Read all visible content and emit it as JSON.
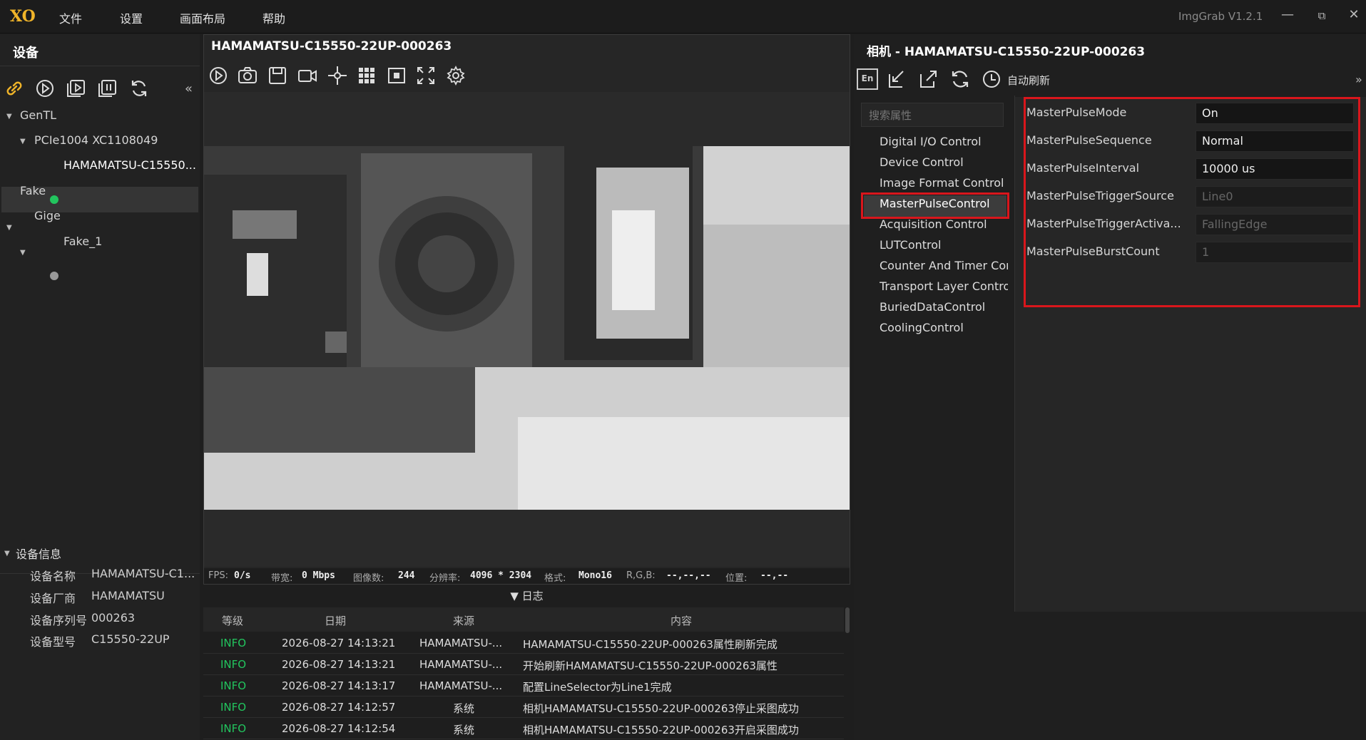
{
  "titlebar": {
    "logo": "XO",
    "menus": [
      "文件",
      "设置",
      "画面布局",
      "帮助"
    ],
    "app_version": "ImgGrab V1.2.1",
    "min_glyph": "—",
    "max_glyph": "⧉",
    "close_glyph": "✕"
  },
  "left_panel": {
    "title": "设备",
    "collapse_glyph": "«",
    "tree": {
      "gentl": "GenTL",
      "pcie": "PCIe1004 XC1108049",
      "hamamatsu": "HAMAMATSU-C15550...",
      "fake": "Fake",
      "gige": "Gige",
      "fake1": "Fake_1"
    },
    "info_title": "设备信息",
    "info": [
      {
        "label": "设备名称",
        "value": "HAMAMATSU-C1..."
      },
      {
        "label": "设备厂商",
        "value": "HAMAMATSU"
      },
      {
        "label": "设备序列号",
        "value": "000263"
      },
      {
        "label": "设备型号",
        "value": "C15550-22UP"
      }
    ]
  },
  "viewer": {
    "title": "HAMAMATSU-C15550-22UP-000263",
    "status": {
      "fps_label": "FPS:",
      "fps": "0/s",
      "bw_label": "带宽:",
      "bw": "0 Mbps",
      "count_label": "图像数:",
      "count": "244",
      "res_label": "分辨率:",
      "res": "4096 * 2304",
      "fmt_label": "格式:",
      "fmt": "Mono16",
      "rgb_label": "R,G,B:",
      "rgb": "--,--,--",
      "pos_label": "位置:",
      "pos": "--,--"
    }
  },
  "log": {
    "title": "▼ 日志",
    "columns": {
      "level": "等级",
      "date": "日期",
      "source": "来源",
      "content": "内容"
    },
    "rows": [
      {
        "level": "INFO",
        "date": "2026-08-27 14:13:21",
        "source": "HAMAMATSU-...",
        "content": "HAMAMATSU-C15550-22UP-000263属性刷新完成"
      },
      {
        "level": "INFO",
        "date": "2026-08-27 14:13:21",
        "source": "HAMAMATSU-...",
        "content": "开始刷新HAMAMATSU-C15550-22UP-000263属性"
      },
      {
        "level": "INFO",
        "date": "2026-08-27 14:13:17",
        "source": "HAMAMATSU-...",
        "content": "配置LineSelector为Line1完成"
      },
      {
        "level": "INFO",
        "date": "2026-08-27 14:12:57",
        "source": "系统",
        "content": "相机HAMAMATSU-C15550-22UP-000263停止采图成功"
      },
      {
        "level": "INFO",
        "date": "2026-08-27 14:12:54",
        "source": "系统",
        "content": "相机HAMAMATSU-C15550-22UP-000263开启采图成功"
      }
    ]
  },
  "props": {
    "title": "相机 - HAMAMATSU-C15550-22UP-000263",
    "auto_refresh": "自动刷新",
    "expand_glyph": "»",
    "lang_glyph": "En",
    "search_placeholder": "搜索属性",
    "categories": [
      "Digital I/O Control",
      "Device Control",
      "Image Format Control",
      "MasterPulseControl",
      "Acquisition Control",
      "LUTControl",
      "Counter And Timer Cor",
      "Transport Layer Contro",
      "BuriedDataControl",
      "CoolingControl"
    ],
    "properties": [
      {
        "name": "MasterPulseMode",
        "value": "On"
      },
      {
        "name": "MasterPulseSequence",
        "value": "Normal"
      },
      {
        "name": "MasterPulseInterval",
        "value": "10000 us"
      },
      {
        "name": "MasterPulseTriggerSource",
        "value": "Line0"
      },
      {
        "name": "MasterPulseTriggerActiva...",
        "value": "FallingEdge"
      },
      {
        "name": "MasterPulseBurstCount",
        "value": "1"
      }
    ]
  },
  "colors": {
    "accent_red": "#d9161c",
    "status_green": "#22c55e",
    "logo_gold": "#f0b429"
  }
}
